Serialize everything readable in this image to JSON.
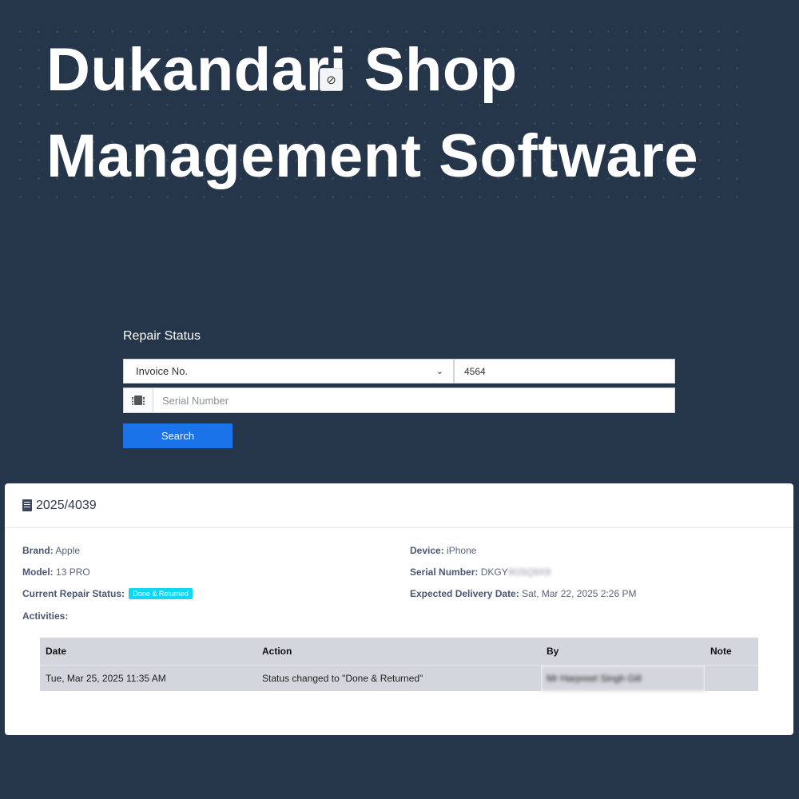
{
  "hero": {
    "line1": "Dukandari Shop",
    "line2": "Management Software"
  },
  "overlay": {
    "icon": "block-icon"
  },
  "search": {
    "heading": "Repair Status",
    "select_value": "Invoice No.",
    "invoice_value": "4564",
    "serial_placeholder": "Serial Number",
    "serial_icon": "chip-icon",
    "button_label": "Search"
  },
  "result": {
    "title": "2025/4039",
    "title_icon": "receipt-icon",
    "brand_label": "Brand:",
    "brand_value": "Apple",
    "model_label": "Model:",
    "model_value": "13 PRO",
    "status_label": "Current Repair Status:",
    "status_value": "Done & Returned",
    "status_color": "#11d8f2",
    "activities_label": "Activities:",
    "device_label": "Device:",
    "device_value": "iPhone",
    "serial_label": "Serial Number:",
    "serial_value": "DKGY",
    "serial_blurred": "9G5Q9X9",
    "delivery_label": "Expected Delivery Date:",
    "delivery_value": "Sat, Mar 22, 2025 2:26 PM"
  },
  "activities": {
    "columns": [
      "Date",
      "Action",
      "By",
      "Note"
    ],
    "rows": [
      {
        "date": "Tue, Mar 25, 2025 11:35 AM",
        "action": "Status changed to \"Done & Returned\"",
        "by": "Mr Harpreet Singh Gill",
        "note": ""
      }
    ]
  },
  "colors": {
    "background": "#25354a",
    "primary_button": "#1a73e8"
  }
}
